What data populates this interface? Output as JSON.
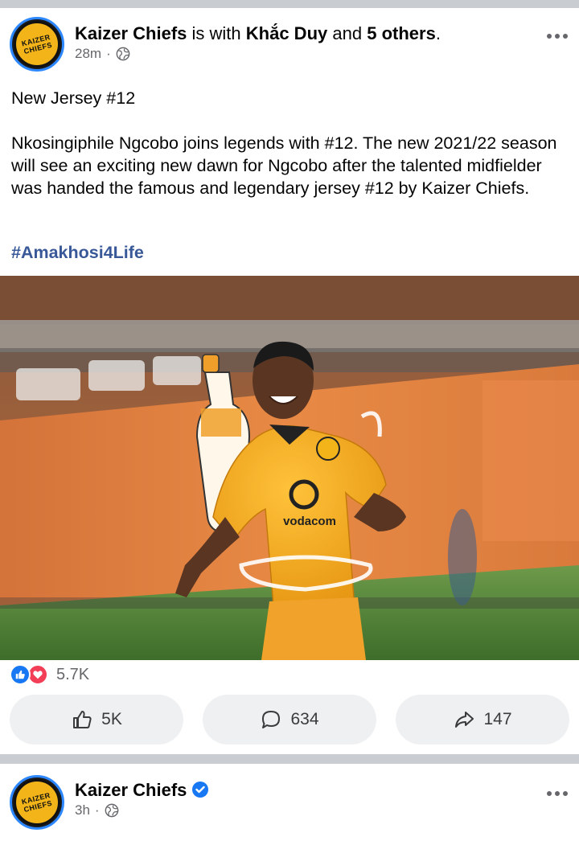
{
  "post1": {
    "author": "Kaizer Chiefs",
    "with_text": "is with",
    "tagged": "Khắc Duy",
    "and_text": "and",
    "others": "5 others",
    "period": ".",
    "time": "28m",
    "dot": "·",
    "title": "New Jersey #12",
    "body": "Nkosingiphile Ngcobo joins legends with #12. The new 2021/22 season will see an exciting new dawn for Ngcobo after the talented midfielder was handed the famous and legendary jersey #12 by Kaizer Chiefs.",
    "hashtag": "#Amakhosi4Life",
    "image": {
      "jersey_sponsor": "vodacom",
      "crest_text": "KAIZER CHIEFS"
    },
    "reactions_count": "5.7K",
    "likes": "5K",
    "comments": "634",
    "shares": "147"
  },
  "post2": {
    "author": "Kaizer Chiefs",
    "time": "3h",
    "dot": "·"
  },
  "avatar_text": "KAIZER CHIEFS",
  "colors": {
    "brand_gold": "#f2b418",
    "link_blue": "#385898",
    "like_blue": "#1877f2",
    "love_red": "#f33e58",
    "button_bg": "#eff0f2",
    "divider": "#c9ccd1"
  },
  "icons": [
    "more-icon",
    "globe-icon",
    "like-icon",
    "comment-icon",
    "share-icon",
    "verified-icon",
    "like-reaction-icon",
    "love-reaction-icon"
  ]
}
